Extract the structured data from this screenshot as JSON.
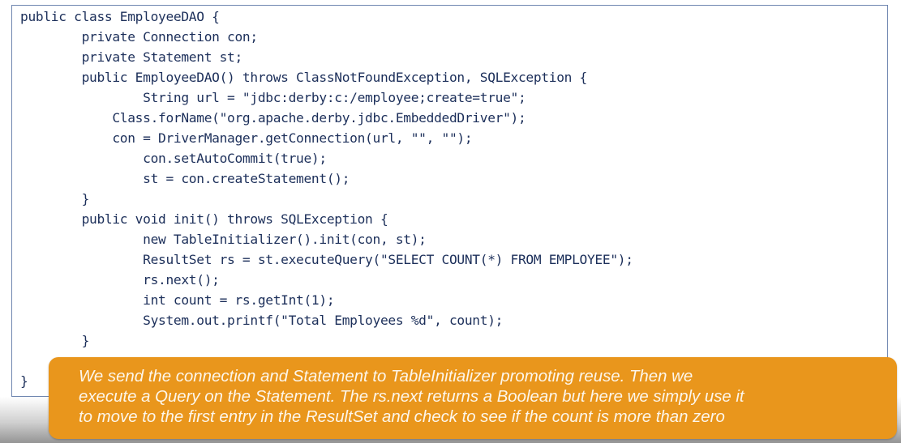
{
  "code": {
    "lines": [
      "public class EmployeeDAO {",
      "        private Connection con;",
      "        private Statement st;",
      "        public EmployeeDAO() throws ClassNotFoundException, SQLException {",
      "                String url = \"jdbc:derby:c:/employee;create=true\";",
      "            Class.forName(\"org.apache.derby.jdbc.EmbeddedDriver\");",
      "            con = DriverManager.getConnection(url, \"\", \"\");",
      "                con.setAutoCommit(true);",
      "                st = con.createStatement();",
      "        }",
      "        public void init() throws SQLException {",
      "                new TableInitializer().init(con, st);",
      "                ResultSet rs = st.executeQuery(\"SELECT COUNT(*) FROM EMPLOYEE\");",
      "                rs.next();",
      "                int count = rs.getInt(1);",
      "                System.out.printf(\"Total Employees %d\", count);",
      "        }",
      "",
      "}"
    ]
  },
  "caption": {
    "lines": [
      "We send the connection and Statement to TableInitializer promoting reuse. Then we",
      "execute a Query on the Statement. The rs.next returns a Boolean but here we simply use it",
      "to move to the first entry in the ResultSet and check to see if the count is more than zero"
    ]
  },
  "colors": {
    "code_text": "#1c2f5a",
    "code_border": "#6f86b0",
    "caption_background": "#e9961c",
    "caption_text": "#fdf6ea"
  }
}
